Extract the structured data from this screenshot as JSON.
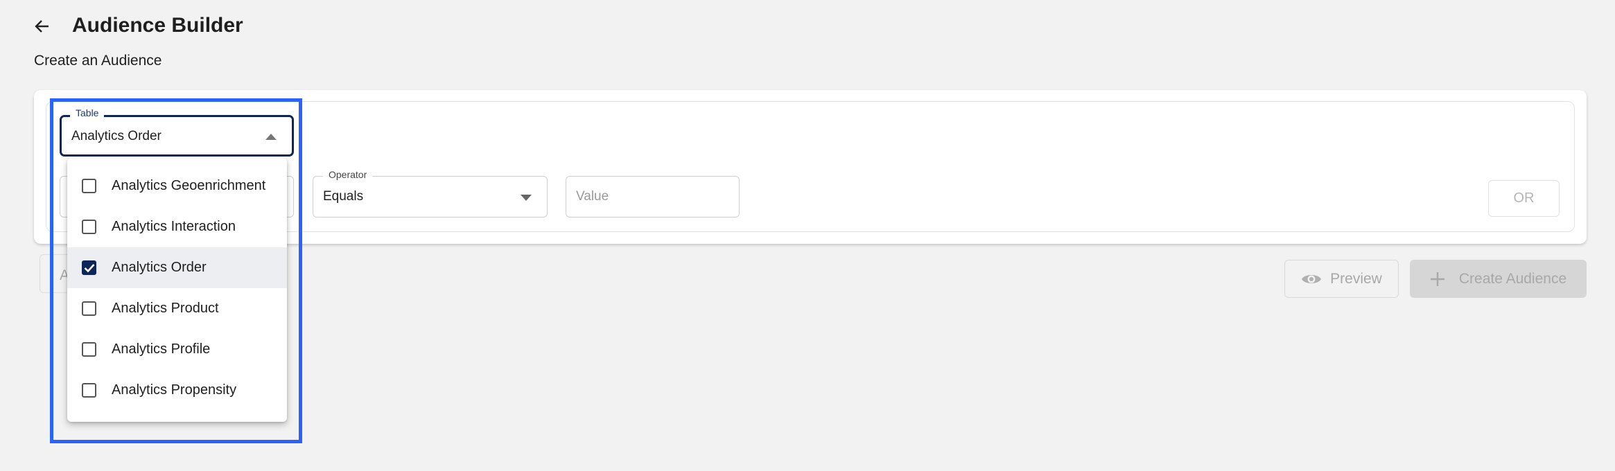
{
  "header": {
    "title": "Audience Builder",
    "subtitle": "Create an Audience",
    "back_icon": "arrow-left-icon"
  },
  "colors": {
    "highlight": "#2962ff",
    "accent": "#0d2657",
    "disabled_bg": "#d6d6d6"
  },
  "filter": {
    "table": {
      "label": "Table",
      "value": "Analytics Order",
      "expanded": true
    },
    "operator": {
      "label": "Operator",
      "value": "Equals"
    },
    "value": {
      "placeholder": "Value"
    },
    "or_label": "OR"
  },
  "dropdown": {
    "options": [
      {
        "label": "Analytics Geoenrichment",
        "checked": false
      },
      {
        "label": "Analytics Interaction",
        "checked": false
      },
      {
        "label": "Analytics Order",
        "checked": true
      },
      {
        "label": "Analytics Product",
        "checked": false
      },
      {
        "label": "Analytics Profile",
        "checked": false
      },
      {
        "label": "Analytics Propensity",
        "checked": false
      }
    ]
  },
  "actions": {
    "add_partial": "A",
    "preview_label": "Preview",
    "preview_icon": "eye-icon",
    "create_label": "Create Audience",
    "create_icon": "plus-icon"
  }
}
